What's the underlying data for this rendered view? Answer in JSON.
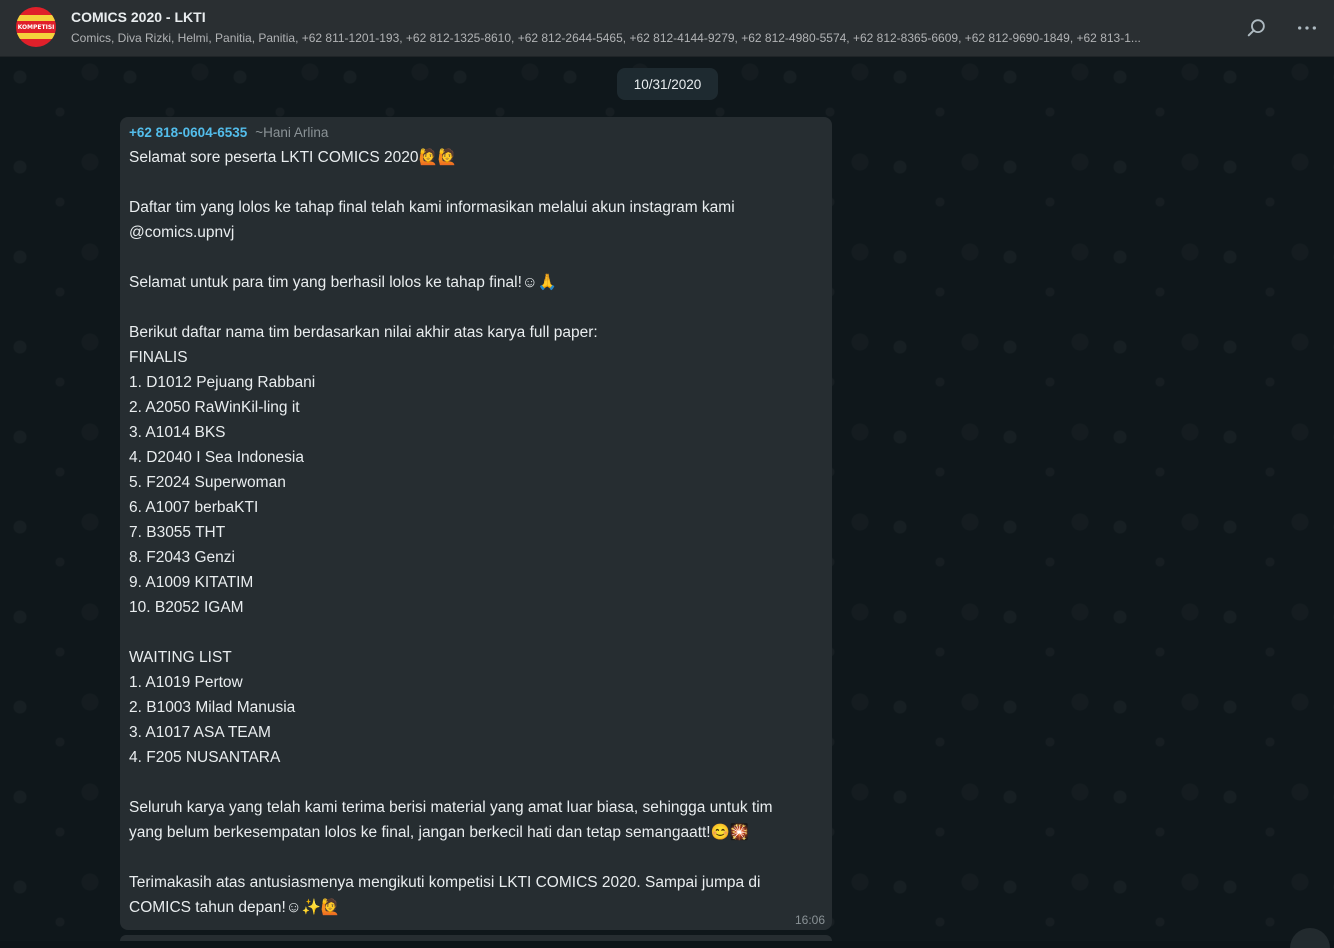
{
  "header": {
    "avatar_label": "KOMPETISI",
    "title": "COMICS 2020 - LKTI",
    "participants": "Comics, Diva Rizki, Helmi, Panitia, Panitia, +62 811-1201-193, +62 812-1325-8610, +62 812-2644-5465, +62 812-4144-9279, +62 812-4980-5574, +62 812-8365-6609, +62 812-9690-1849, +62 813-1...",
    "search_icon": "search-icon",
    "menu_icon": "more-vertical-icon"
  },
  "chat": {
    "date_chip": "10/31/2020",
    "message": {
      "sender_phone": "+62 818-0604-6535",
      "sender_name": "~Hani Arlina",
      "lines": [
        "Selamat sore peserta LKTI COMICS 2020🙋🙋",
        "",
        "Daftar tim yang lolos ke tahap final telah kami informasikan melalui akun instagram kami",
        "@comics.upnvj",
        "",
        "Selamat untuk para tim yang berhasil lolos ke tahap final!☺🙏",
        "",
        "Berikut daftar nama tim berdasarkan nilai akhir atas karya full paper:",
        "FINALIS",
        "1. D1012 Pejuang Rabbani",
        "2. A2050 RaWinKil-ling it",
        "3. A1014 BKS",
        "4. D2040 I Sea Indonesia",
        "5. F2024 Superwoman",
        "6. A1007 berbaKTI",
        "7. B3055 THT",
        "8. F2043 Genzi",
        "9. A1009 KITATIM",
        "10. B2052 IGAM",
        "",
        "WAITING LIST",
        "1. A1019 Pertow",
        "2. B1003 Milad Manusia",
        "3. A1017 ASA TEAM",
        "4. F205 NUSANTARA",
        "",
        "Seluruh karya yang telah kami terima berisi material yang amat luar biasa, sehingga untuk tim",
        "yang belum berkesempatan lolos ke final, jangan berkecil hati dan tetap semangaatt!😊🎇",
        "",
        "Terimakasih atas antusiasmenya mengikuti kompetisi LKTI COMICS 2020. Sampai jumpa di",
        "COMICS tahun depan!☺✨🙋"
      ],
      "time": "16:06"
    }
  }
}
